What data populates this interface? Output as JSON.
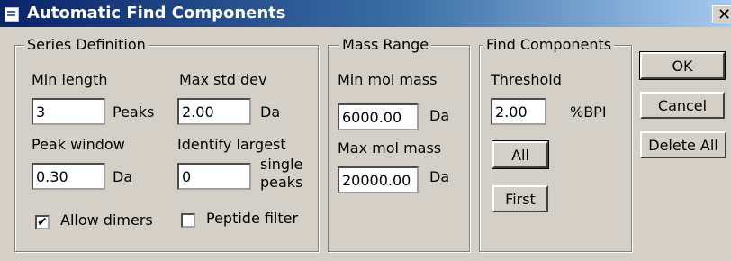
{
  "window": {
    "title": "Automatic Find Components",
    "close_glyph": "✕"
  },
  "series_definition": {
    "legend": "Series Definition",
    "min_length": {
      "label": "Min length",
      "value": "3",
      "unit": "Peaks"
    },
    "max_std_dev": {
      "label": "Max std dev",
      "value": "2.00",
      "unit": "Da"
    },
    "peak_window": {
      "label": "Peak window",
      "value": "0.30",
      "unit": "Da"
    },
    "identify_largest": {
      "label": "Identify largest",
      "value": "0",
      "unit_line1": "single",
      "unit_line2": "peaks"
    },
    "allow_dimers": {
      "label": "Allow dimers",
      "checked": true
    },
    "peptide_filter": {
      "label": "Peptide filter",
      "checked": false
    }
  },
  "mass_range": {
    "legend": "Mass Range",
    "min_mol_mass": {
      "label": "Min mol mass",
      "value": "6000.00",
      "unit": "Da"
    },
    "max_mol_mass": {
      "label": "Max mol mass",
      "value": "20000.00",
      "unit": "Da"
    }
  },
  "find_components": {
    "legend": "Find Components",
    "threshold": {
      "label": "Threshold",
      "value": "2.00",
      "unit": "%BPI"
    },
    "all_label": "All",
    "first_label": "First"
  },
  "buttons": {
    "ok": "OK",
    "cancel": "Cancel",
    "delete_all": "Delete All"
  },
  "check_glyph": "✔"
}
